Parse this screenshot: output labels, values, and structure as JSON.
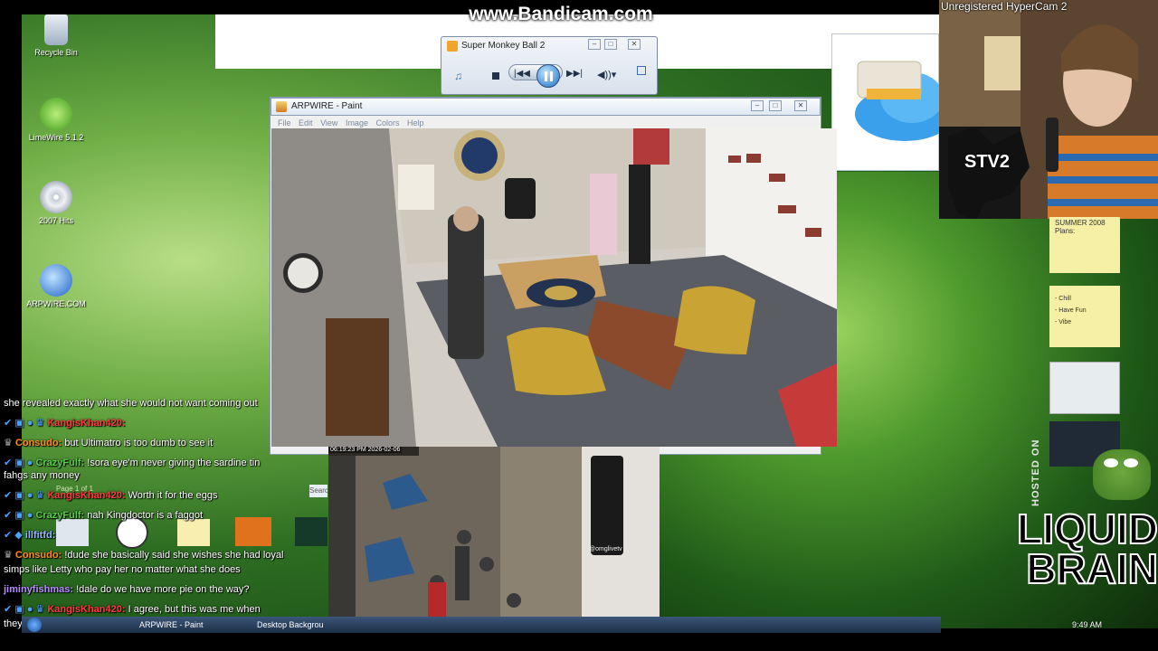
{
  "watermark": "www.Bandicam.com",
  "hypercam": "Unregistered HyperCam 2",
  "desktop_icons": [
    {
      "label": "Recycle Bin",
      "icon": "recycle-bin-icon"
    },
    {
      "label": "LimeWire 5.1.2",
      "icon": "limewire-icon"
    },
    {
      "label": "2007 Hits",
      "icon": "cd-icon"
    },
    {
      "label": "ARPWIRE.COM",
      "icon": "internet-explorer-icon"
    }
  ],
  "media_player": {
    "title": "Super Monkey Ball 2"
  },
  "paint": {
    "title": "ARPWIRE - Paint",
    "menu": [
      "File",
      "Edit",
      "View",
      "Image",
      "Colors",
      "Help"
    ]
  },
  "street_feed": {
    "timestamp": "06:19:23 PM 2026-02-06",
    "watermark": "@omglivetv"
  },
  "webcam_sticker": "STV2",
  "sticky_notes": {
    "note1": "SUMMER 2008 Plans:",
    "note2_lines": [
      "- Chill",
      "- Have Fun",
      "- Vibe"
    ]
  },
  "side_text": "HOSTED ON",
  "brand": [
    "LIQUID",
    "BRAIN"
  ],
  "behind_chat": {
    "page_label": "Page 1 of 1",
    "search_label": "Searc"
  },
  "chat": [
    {
      "user": "",
      "text": "she revealed exactly what she would not want coming out",
      "color": "#ffffff"
    },
    {
      "user": "KangisKhan420:",
      "text": "",
      "color": "#ff3b3b"
    },
    {
      "user": "Consudo:",
      "text": "but Ultimatro is too dumb to see it",
      "color": "#ff8c1a"
    },
    {
      "user": "CrazyFulf:",
      "text": "!sora eye'm never giving the sardine tin",
      "color": "#59d14a"
    },
    {
      "user": "",
      "text": "fahgs any money",
      "color": "#ffffff"
    },
    {
      "user": "KangisKhan420:",
      "text": "Worth it for the eggs",
      "color": "#ff3b3b"
    },
    {
      "user": "CrazyFulf:",
      "text": "nah Kingdoctor is a faggot",
      "color": "#59d14a"
    },
    {
      "user": "illfitfd:",
      "text": "",
      "color": "#8fb6ff"
    },
    {
      "user": "Consudo:",
      "text": "!dude she basically said she wishes she had loyal",
      "color": "#ff8c1a"
    },
    {
      "user": "",
      "text": "simps like Letty who pay her no matter what she does",
      "color": "#ffffff"
    },
    {
      "user": "jiminyfishmas:",
      "text": "!dale do we have more pie on the way?",
      "color": "#b58cff"
    },
    {
      "user": "KangisKhan420:",
      "text": "I agree, but this was me when",
      "color": "#ff3b3b"
    },
    {
      "user": "",
      "text": "they egg that bitch",
      "color": "#ffffff"
    }
  ],
  "taskbar": {
    "items": [
      "ARPWIRE - Paint",
      "Desktop Backgrou"
    ],
    "clock": "9:49 AM"
  }
}
